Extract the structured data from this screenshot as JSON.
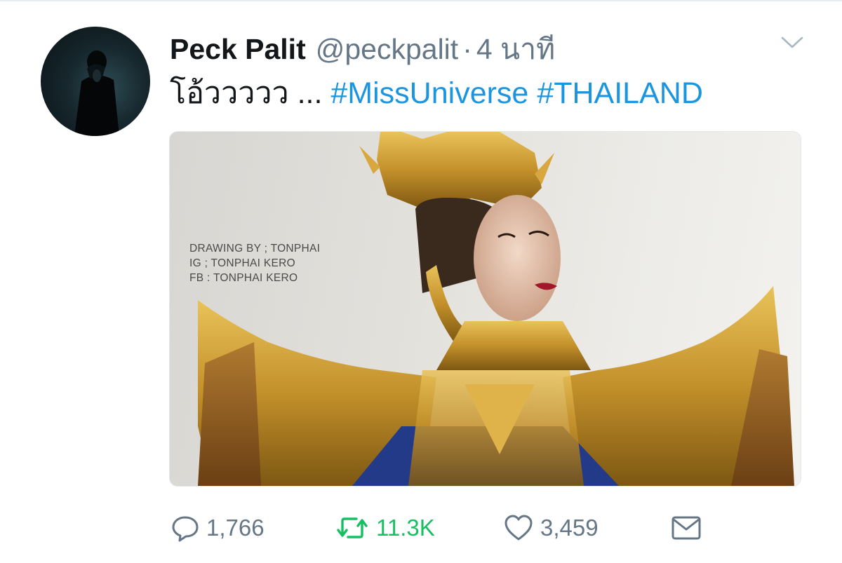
{
  "tweet": {
    "author_name": "Peck Palit",
    "handle": "@peckpalit",
    "separator": "·",
    "time": "4 นาที",
    "text_prefix": "โอ้ววววว ... ",
    "hashtags": [
      "#MissUniverse",
      "#THAILAND"
    ]
  },
  "media": {
    "alt_subject": "illustration of woman in Thai gold costume",
    "credit_lines": [
      "DRAWING BY ; TONPHAI",
      "IG ; TONPHAI KERO",
      "FB : TONPHAI KERO"
    ]
  },
  "actions": {
    "replies": "1,766",
    "retweets": "11.3K",
    "likes": "3,459"
  },
  "icons": {
    "reply": "reply-bubble-icon",
    "retweet": "retweet-icon",
    "like": "heart-icon",
    "dm": "envelope-icon",
    "menu": "chevron-down-icon"
  },
  "colors": {
    "hashtag": "#1b95e0",
    "retweet_active": "#17bf63",
    "muted": "#657786",
    "text": "#14171a"
  }
}
